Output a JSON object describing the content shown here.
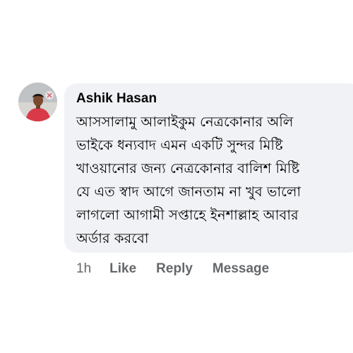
{
  "comment": {
    "author": "Ashik Hasan",
    "text_lines": [
      "আসসালামু আলাইকুম নেত্রকোনার অলি",
      "ভাইকে ধন্যবাদ এমন একটি সুন্দর মিষ্টি",
      "খাওয়ানোর জন্য নেত্রকোনার বালিশ মিষ্টি",
      "যে এত স্বাদ আগে জানতাম না খুব ভালো",
      "লাগলো আগামী সপ্তাহে ইনশাল্লাহ আবার",
      "অর্ডার করবো"
    ],
    "avatar_icon": "profile-photo",
    "timestamp": "1h",
    "actions": {
      "like": "Like",
      "reply": "Reply",
      "message": "Message"
    }
  },
  "colors": {
    "bubble_bg": "#f0f2f5",
    "text": "#050505",
    "meta": "#65676b"
  }
}
